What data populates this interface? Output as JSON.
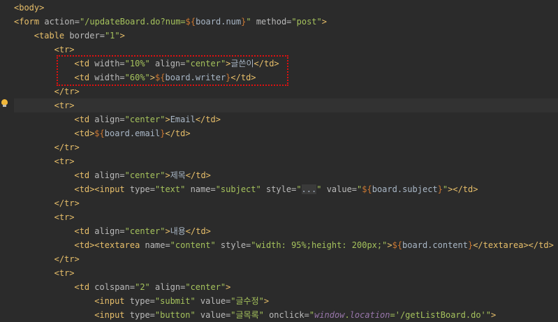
{
  "lines": [
    {
      "t": [
        {
          "c": "tag",
          "s": "<body>"
        }
      ]
    },
    {
      "t": [
        {
          "c": "tag",
          "s": "<form "
        },
        {
          "c": "attr",
          "s": "action="
        },
        {
          "c": "val",
          "s": "\"/updateBoard.do?num="
        },
        {
          "c": "punct",
          "s": "${"
        },
        {
          "c": "txt",
          "s": "board.num"
        },
        {
          "c": "punct",
          "s": "}"
        },
        {
          "c": "val",
          "s": "\" "
        },
        {
          "c": "attr",
          "s": "method="
        },
        {
          "c": "val",
          "s": "\"post\""
        },
        {
          "c": "tag",
          "s": ">"
        }
      ]
    },
    {
      "t": [
        {
          "c": "tag",
          "s": "<table "
        },
        {
          "c": "attr",
          "s": "border="
        },
        {
          "c": "val",
          "s": "\"1\""
        },
        {
          "c": "tag",
          "s": ">"
        }
      ]
    },
    {
      "t": [
        {
          "c": "tag",
          "s": "<tr>"
        }
      ]
    },
    {
      "t": [
        {
          "c": "tag",
          "s": "<td "
        },
        {
          "c": "attr",
          "s": "width="
        },
        {
          "c": "val",
          "s": "\"10%\" "
        },
        {
          "c": "attr",
          "s": "align="
        },
        {
          "c": "val",
          "s": "\"center\""
        },
        {
          "c": "tag",
          "s": ">"
        },
        {
          "c": "txt",
          "s": "글쓴이"
        },
        {
          "c": "tag",
          "s": "</td>"
        }
      ]
    },
    {
      "t": [
        {
          "c": "tag",
          "s": "<td "
        },
        {
          "c": "attr",
          "s": "width="
        },
        {
          "c": "val",
          "s": "\"60%\""
        },
        {
          "c": "tag",
          "s": ">"
        },
        {
          "c": "punct",
          "s": "${"
        },
        {
          "c": "txt",
          "s": "board.writer"
        },
        {
          "c": "punct",
          "s": "}"
        },
        {
          "c": "tag",
          "s": "</td>"
        }
      ]
    },
    {
      "t": [
        {
          "c": "tag",
          "s": "</tr>"
        }
      ]
    },
    {
      "t": [
        {
          "c": "tag",
          "s": "<tr>"
        }
      ]
    },
    {
      "t": [
        {
          "c": "tag",
          "s": "<td "
        },
        {
          "c": "attr",
          "s": "align="
        },
        {
          "c": "val",
          "s": "\"center\""
        },
        {
          "c": "tag",
          "s": ">"
        },
        {
          "c": "txt",
          "s": "Email"
        },
        {
          "c": "tag",
          "s": "</td>"
        }
      ]
    },
    {
      "t": [
        {
          "c": "tag",
          "s": "<td>"
        },
        {
          "c": "punct",
          "s": "${"
        },
        {
          "c": "txt",
          "s": "board.email"
        },
        {
          "c": "punct",
          "s": "}"
        },
        {
          "c": "tag",
          "s": "</td>"
        }
      ]
    },
    {
      "t": [
        {
          "c": "tag",
          "s": "</tr>"
        }
      ]
    },
    {
      "t": [
        {
          "c": "tag",
          "s": "<tr>"
        }
      ]
    },
    {
      "t": [
        {
          "c": "tag",
          "s": "<td "
        },
        {
          "c": "attr",
          "s": "align="
        },
        {
          "c": "val",
          "s": "\"center\""
        },
        {
          "c": "tag",
          "s": ">"
        },
        {
          "c": "txt",
          "s": "제목"
        },
        {
          "c": "tag",
          "s": "</td>"
        }
      ]
    },
    {
      "t": [
        {
          "c": "tag",
          "s": "<td><input "
        },
        {
          "c": "attr",
          "s": "type="
        },
        {
          "c": "val",
          "s": "\"text\" "
        },
        {
          "c": "attr",
          "s": "name="
        },
        {
          "c": "val",
          "s": "\"subject\" "
        },
        {
          "c": "attr",
          "s": "style="
        },
        {
          "c": "val",
          "s": "\""
        },
        {
          "c": "dots",
          "s": "..."
        },
        {
          "c": "val",
          "s": "\" "
        },
        {
          "c": "attr",
          "s": "value="
        },
        {
          "c": "val",
          "s": "\""
        },
        {
          "c": "punct",
          "s": "${"
        },
        {
          "c": "txt",
          "s": "board.subject"
        },
        {
          "c": "punct",
          "s": "}"
        },
        {
          "c": "val",
          "s": "\""
        },
        {
          "c": "tag",
          "s": "></td>"
        }
      ]
    },
    {
      "t": [
        {
          "c": "tag",
          "s": "</tr>"
        }
      ]
    },
    {
      "t": [
        {
          "c": "tag",
          "s": "<tr>"
        }
      ]
    },
    {
      "t": [
        {
          "c": "tag",
          "s": "<td "
        },
        {
          "c": "attr",
          "s": "align="
        },
        {
          "c": "val",
          "s": "\"center\""
        },
        {
          "c": "tag",
          "s": ">"
        },
        {
          "c": "txt",
          "s": "내용"
        },
        {
          "c": "tag",
          "s": "</td>"
        }
      ]
    },
    {
      "t": [
        {
          "c": "tag",
          "s": "<td><textarea "
        },
        {
          "c": "attr",
          "s": "name="
        },
        {
          "c": "val",
          "s": "\"content\" "
        },
        {
          "c": "attr",
          "s": "style="
        },
        {
          "c": "val",
          "s": "\"width: 95%;height: 200px;\""
        },
        {
          "c": "tag",
          "s": ">"
        },
        {
          "c": "punct",
          "s": "${"
        },
        {
          "c": "txt",
          "s": "board.content"
        },
        {
          "c": "punct",
          "s": "}"
        },
        {
          "c": "tag",
          "s": "</textarea></td>"
        }
      ]
    },
    {
      "t": [
        {
          "c": "tag",
          "s": "</tr>"
        }
      ]
    },
    {
      "t": [
        {
          "c": "tag",
          "s": "<tr>"
        }
      ]
    },
    {
      "t": [
        {
          "c": "tag",
          "s": "<td "
        },
        {
          "c": "attr",
          "s": "colspan="
        },
        {
          "c": "val",
          "s": "\"2\" "
        },
        {
          "c": "attr",
          "s": "align="
        },
        {
          "c": "val",
          "s": "\"center\""
        },
        {
          "c": "tag",
          "s": ">"
        }
      ]
    },
    {
      "t": [
        {
          "c": "tag",
          "s": "<input "
        },
        {
          "c": "attr",
          "s": "type="
        },
        {
          "c": "val",
          "s": "\"submit\" "
        },
        {
          "c": "attr",
          "s": "value="
        },
        {
          "c": "val",
          "s": "\"글수정\""
        },
        {
          "c": "tag",
          "s": ">"
        }
      ]
    },
    {
      "t": [
        {
          "c": "tag",
          "s": "<input "
        },
        {
          "c": "attr",
          "s": "type="
        },
        {
          "c": "val",
          "s": "\"button\" "
        },
        {
          "c": "attr",
          "s": "value="
        },
        {
          "c": "val",
          "s": "\"글목록\" "
        },
        {
          "c": "attr",
          "s": "onclick="
        },
        {
          "c": "val",
          "s": "\""
        },
        {
          "c": "italic",
          "s": "window"
        },
        {
          "c": "val",
          "s": "."
        },
        {
          "c": "italic",
          "s": "location"
        },
        {
          "c": "val",
          "s": "='/getListBoard.do'\""
        },
        {
          "c": "tag",
          "s": ">"
        }
      ]
    }
  ],
  "icons": {
    "gutter": "lightbulb-icon"
  },
  "colors": {
    "background": "#2b2b2b",
    "tag": "#e8bf6a",
    "value": "#a5c25c",
    "highlight_box": "#e01010"
  }
}
